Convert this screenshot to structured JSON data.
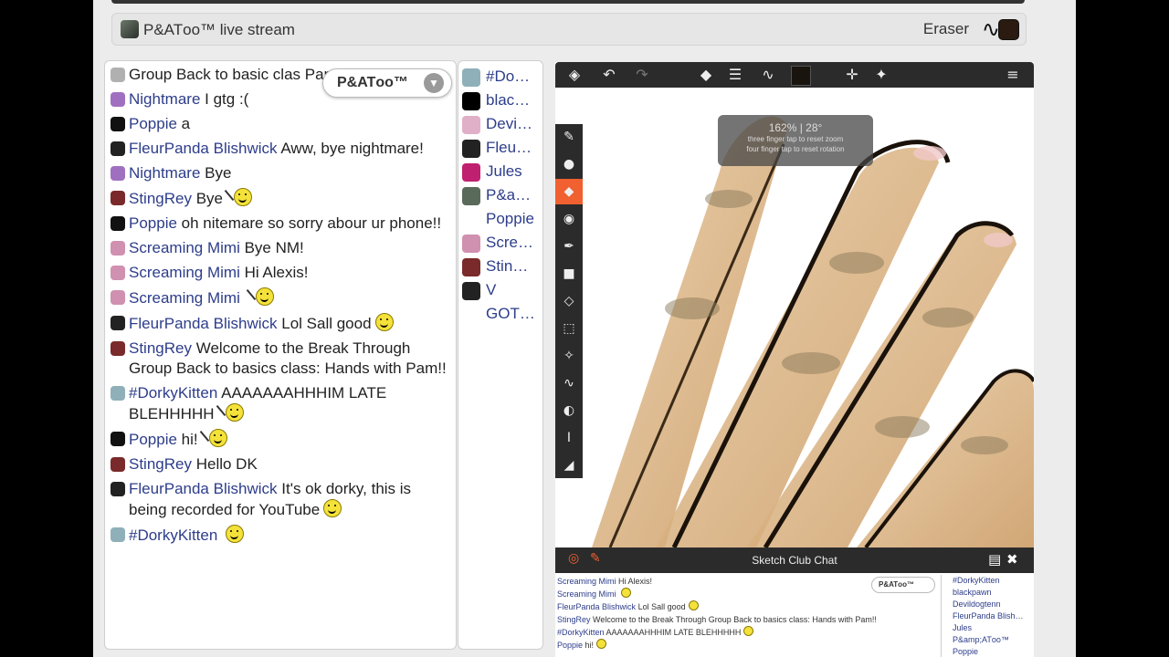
{
  "titlebar": {
    "title": "P&ATоo™ live stream",
    "tool_label": "Eraser",
    "tool_glyph": "∿",
    "swatch_color": "#2a1a10"
  },
  "chat": {
    "filter_pill": "P&ATоo™",
    "messages": [
      {
        "user": "",
        "text": "Group Back to basic clas Pam!!",
        "avatar": "#b0b0b0",
        "smiley": false,
        "wave": false
      },
      {
        "user": "Nightmare",
        "text": "I gtg :(",
        "avatar": "#a070c0",
        "smiley": false,
        "wave": false
      },
      {
        "user": "Poppie",
        "text": "a",
        "avatar": "#111",
        "smiley": false,
        "wave": false
      },
      {
        "user": "FleurPanda Blishwick",
        "text": "Aww, bye nightmare!",
        "avatar": "#222",
        "smiley": false,
        "wave": false
      },
      {
        "user": "Nightmare",
        "text": "Bye",
        "avatar": "#a070c0",
        "smiley": false,
        "wave": false
      },
      {
        "user": "StingRey",
        "text": "Bye",
        "avatar": "#7a2a2a",
        "smiley": true,
        "wave": true
      },
      {
        "user": "Poppie",
        "text": "oh nitemare so sorry abour ur phone!!",
        "avatar": "#111",
        "smiley": false,
        "wave": false
      },
      {
        "user": "Screaming Mimi",
        "text": "Bye NM!",
        "avatar": "#d090b0",
        "smiley": false,
        "wave": false
      },
      {
        "user": "Screaming Mimi",
        "text": "Hi Alexis!",
        "avatar": "#d090b0",
        "smiley": false,
        "wave": false
      },
      {
        "user": "Screaming Mimi",
        "text": "",
        "avatar": "#d090b0",
        "smiley": true,
        "wave": true
      },
      {
        "user": "FleurPanda Blishwick",
        "text": "Lol Sall good",
        "avatar": "#222",
        "smiley": true,
        "wave": false
      },
      {
        "user": "StingRey",
        "text": "Welcome to the Break Through Group Back to basics class: Hands with Pam!!",
        "avatar": "#7a2a2a",
        "smiley": false,
        "wave": false
      },
      {
        "user": "#DorkyKitten",
        "text": "AAAAAAAHHHIM LATE BLEHHHHH",
        "avatar": "#8fb0b8",
        "smiley": true,
        "wave": true
      },
      {
        "user": "Poppie",
        "text": "hi!",
        "avatar": "#111",
        "smiley": true,
        "wave": true
      },
      {
        "user": "StingRey",
        "text": "Hello DK",
        "avatar": "#7a2a2a",
        "smiley": false,
        "wave": false
      },
      {
        "user": "FleurPanda Blishwick",
        "text": "It's ok dorky, this is being recorded for YouTube",
        "avatar": "#222",
        "smiley": true,
        "wave": false
      },
      {
        "user": "#DorkyKitten",
        "text": "",
        "avatar": "#8fb0b8",
        "smiley": true,
        "wave": false
      }
    ]
  },
  "userlist": [
    {
      "name": "#Do…",
      "avatar": "#8fb0b8"
    },
    {
      "name": "blac…",
      "avatar": "#000"
    },
    {
      "name": "Devi…",
      "avatar": "#e0b0c8"
    },
    {
      "name": "Fleu…",
      "avatar": "#222"
    },
    {
      "name": "Jules",
      "avatar": "#c02070"
    },
    {
      "name": "P&a…",
      "avatar": "#5a6a5a"
    },
    {
      "name": "Poppie",
      "avatar": "#fff"
    },
    {
      "name": "Scre…",
      "avatar": "#d090b0"
    },
    {
      "name": "Stin…",
      "avatar": "#7a2a2a"
    },
    {
      "name": "V",
      "avatar": "#222"
    },
    {
      "name": "GOT…",
      "avatar": "#fff"
    }
  ],
  "canvas": {
    "zoom_text": "162%  |  28°",
    "hint1": "three finger tap to reset zoom",
    "hint2": "four finger tap to reset rotation",
    "toolbar_icons": [
      "layers-icon",
      "undo-icon",
      "redo-icon",
      "eraser-icon",
      "sliders-icon",
      "brush-stroke-icon",
      "color-chip",
      "move-icon",
      "magic-wand-icon",
      "menu-icon"
    ],
    "left_tools": [
      "brush-icon",
      "drop-icon",
      "eraser-tool-icon",
      "fill-icon",
      "pen-icon",
      "shapes-icon",
      "transform-icon",
      "select-icon",
      "smudge-icon",
      "stroke-icon",
      "blend-icon",
      "text-icon",
      "ruler-icon"
    ],
    "accent": "#f06030"
  },
  "sketch_chat": {
    "title": "Sketch Club Chat",
    "filter_pill": "P&ATоo™",
    "messages": [
      {
        "user": "Screaming Mimi",
        "text": "Hi Alexis!",
        "smiley": false
      },
      {
        "user": "Screaming Mimi",
        "text": "",
        "smiley": true
      },
      {
        "user": "FleurPanda Blishwick",
        "text": "Lol Sall good",
        "smiley": true
      },
      {
        "user": "StingRey",
        "text": "Welcome to the Break Through Group Back to basics class: Hands with Pam!!",
        "smiley": false
      },
      {
        "user": "#DorkyKitten",
        "text": "AAAAAAAHHHIM LATE BLEHHHHH",
        "smiley": true
      },
      {
        "user": "Poppie",
        "text": "hi!",
        "smiley": true
      }
    ],
    "users": [
      "#DorkyKitten",
      "blackpawn",
      "Devildogtenn",
      "FleurPanda Blish…",
      "Jules",
      "P&amp;ATоo™",
      "Poppie"
    ]
  }
}
